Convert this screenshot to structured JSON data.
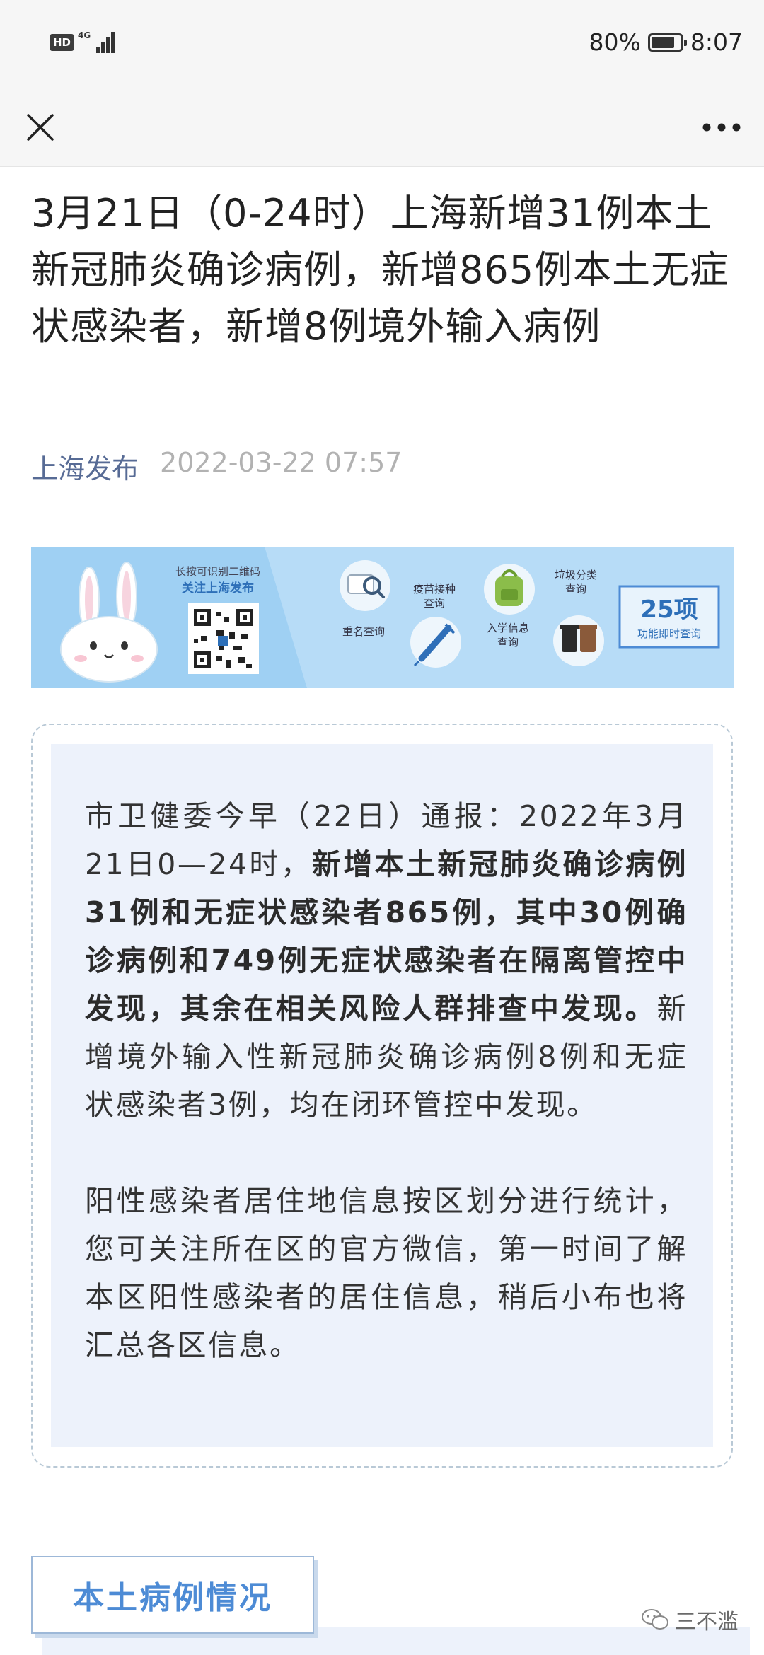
{
  "status_bar": {
    "network_badge": "HD",
    "network_type": "4G",
    "battery_percent": "80%",
    "battery_level": 0.8,
    "time": "8:07"
  },
  "nav": {
    "close_icon": "close-icon",
    "more_icon": "more-options-icon"
  },
  "article": {
    "title": "3月21日（0-24时）上海新增31例本土新冠肺炎确诊病例，新增865例本土无症状感染者，新增8例境外输入病例",
    "author": "上海发布",
    "datetime": "2022-03-22 07:57"
  },
  "banner": {
    "qr_caption_line1": "长按可识别二维码",
    "qr_caption_line2": "关注上海发布",
    "items": [
      {
        "label": "重名查询",
        "icon": "name-search-icon"
      },
      {
        "label": "疫苗接种查询",
        "icon": "syringe-icon"
      },
      {
        "label": "入学信息查询",
        "icon": "backpack-icon"
      },
      {
        "label": "垃圾分类查询",
        "icon": "trash-bins-icon"
      }
    ],
    "count_big": "25项",
    "count_small": "功能即时查询",
    "accent": "#4d8bd5",
    "background": "#b7dcf7"
  },
  "report": {
    "p1_lead": "市卫健委今早（22日）通报：2022年3月21日0—24时，",
    "p1_bold": "新增本土新冠肺炎确诊病例31例和无症状感染者865例，其中30例确诊病例和749例无症状感染者在隔离管控中发现，其余在相关风险人群排查中发现。",
    "p1_tail": "新增境外输入性新冠肺炎确诊病例8例和无症状感染者3例，均在闭环管控中发现。",
    "p2": "阳性感染者居住地信息按区划分进行统计，您可关注所在区的官方微信，第一时间了解本区阳性感染者的居住信息，稍后小布也将汇总各区信息。"
  },
  "section": {
    "heading": "本土病例情况"
  },
  "watermark": {
    "text": "三不滥",
    "icon": "wechat-icon"
  }
}
